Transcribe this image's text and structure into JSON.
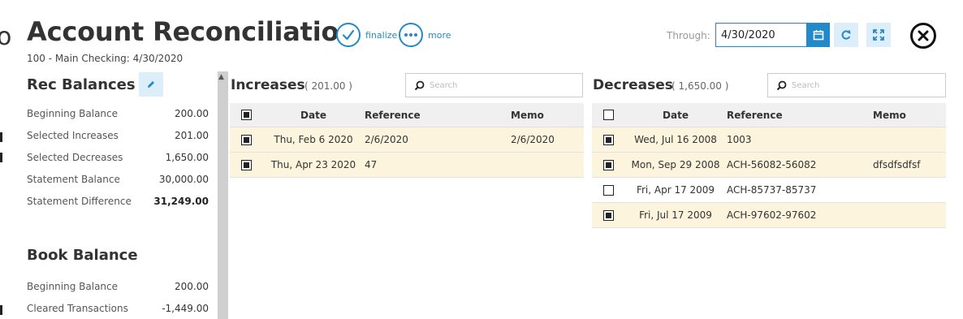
{
  "header": {
    "title": "Account Reconciliation",
    "subtitle": "100 - Main Checking: 4/30/2020",
    "finalize_label": "finalize",
    "more_label": "more",
    "through_label": "Through:",
    "through_value": "4/30/2020",
    "background_letter": "o"
  },
  "rec_balances": {
    "title": "Rec Balances",
    "rows": [
      {
        "label": "Beginning Balance",
        "value": "200.00"
      },
      {
        "label": "Selected Increases",
        "value": "201.00"
      },
      {
        "label": "Selected Decreases",
        "value": "1,650.00"
      },
      {
        "label": "Statement Balance",
        "value": "30,000.00"
      },
      {
        "label": "Statement Difference",
        "value": "31,249.00"
      }
    ]
  },
  "book_balance": {
    "title": "Book Balance",
    "rows": [
      {
        "label": "Beginning Balance",
        "value": "200.00"
      },
      {
        "label": "Cleared Transactions",
        "value": "-1,449.00"
      }
    ]
  },
  "increases": {
    "title": "Increases",
    "total": "( 201.00 )",
    "search_placeholder": "Search",
    "columns": {
      "date": "Date",
      "reference": "Reference",
      "memo": "Memo"
    },
    "rows": [
      {
        "checked": true,
        "date": "Thu, Feb 6 2020",
        "reference": "2/6/2020",
        "memo": "2/6/2020"
      },
      {
        "checked": true,
        "date": "Thu, Apr 23 2020",
        "reference": "47",
        "memo": ""
      }
    ]
  },
  "decreases": {
    "title": "Decreases",
    "total": "( 1,650.00 )",
    "search_placeholder": "Search",
    "columns": {
      "date": "Date",
      "reference": "Reference",
      "memo": "Memo"
    },
    "rows": [
      {
        "checked": true,
        "date": "Wed, Jul 16 2008",
        "reference": "1003",
        "memo": ""
      },
      {
        "checked": true,
        "date": "Mon, Sep 29 2008",
        "reference": "ACH-56082-56082",
        "memo": "dfsdfsdfsf"
      },
      {
        "checked": false,
        "date": "Fri, Apr 17 2009",
        "reference": "ACH-85737-85737",
        "memo": ""
      },
      {
        "checked": true,
        "date": "Fri, Jul 17 2009",
        "reference": "ACH-97602-97602",
        "memo": ""
      }
    ]
  },
  "colors": {
    "accent": "#2389c9",
    "selected_row": "#fcf4dc",
    "header_bg": "#f0f0f0"
  }
}
